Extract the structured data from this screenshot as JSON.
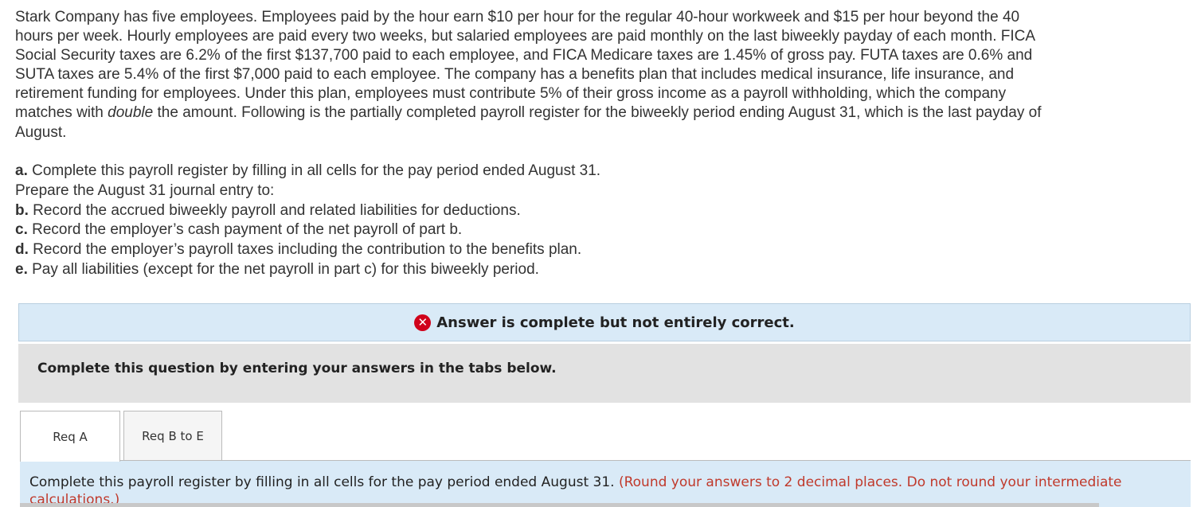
{
  "problem": {
    "part1": "Stark Company has five employees. Employees paid by the hour earn $10 per hour for the regular 40-hour workweek and $15 per hour beyond the 40 hours per week. Hourly employees are paid every two weeks, but salaried employees are paid monthly on the last biweekly payday of each month. FICA Social Security taxes are 6.2% of the first $137,700 paid to each employee, and FICA Medicare taxes are 1.45% of gross pay. FUTA taxes are 0.6% and SUTA taxes are 5.4% of the first $7,000 paid to each employee. The company has a benefits plan that includes medical insurance, life insurance, and retirement funding for employees. Under this plan, employees must contribute 5% of their gross income as a payroll withholding, which the company matches with ",
    "emphasis": "double",
    "part2": " the amount. Following is the partially completed payroll register for the biweekly period ending August 31, which is the last payday of August."
  },
  "tasks": {
    "a_label": "a.",
    "a_text": " Complete this payroll register by filling in all cells for the pay period ended August 31.",
    "prepare": "Prepare the August 31 journal entry to:",
    "b_label": "b.",
    "b_text": " Record the accrued biweekly payroll and related liabilities for deductions.",
    "c_label": "c.",
    "c_text": " Record the employer’s cash payment of the net payroll of part b.",
    "d_label": "d.",
    "d_text": " Record the employer’s payroll taxes including the contribution to the benefits plan.",
    "e_label": "e.",
    "e_text": " Pay all liabilities (except for the net payroll in part c) for this biweekly period."
  },
  "banner": {
    "icon": "x-circle-icon",
    "text": "Answer is complete but not entirely correct.",
    "color": "#d0021b"
  },
  "instructions": "Complete this question by entering your answers in the tabs below.",
  "tabs": [
    {
      "label": "Req A"
    },
    {
      "label": "Req B to E"
    }
  ],
  "content": {
    "text": "Complete this payroll register by filling in all cells for the pay period ended August 31. ",
    "note": "(Round your answers to 2 decimal places. Do not round your intermediate calculations.)"
  }
}
